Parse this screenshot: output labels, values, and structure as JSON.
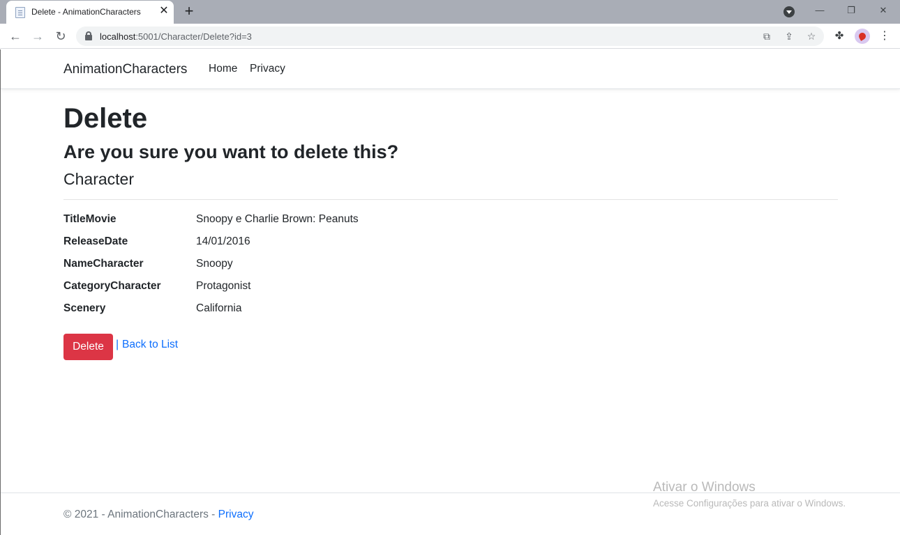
{
  "browser": {
    "tab_title": "Delete - AnimationCharacters",
    "url_host": "localhost",
    "url_path": ":5001/Character/Delete?id=3"
  },
  "site": {
    "brand": "AnimationCharacters",
    "nav": [
      "Home",
      "Privacy"
    ]
  },
  "page": {
    "heading": "Delete",
    "question": "Are you sure you want to delete this?",
    "entity": "Character",
    "fields": [
      {
        "label": "TitleMovie",
        "value": "Snoopy e Charlie Brown: Peanuts"
      },
      {
        "label": "ReleaseDate",
        "value": "14/01/2016"
      },
      {
        "label": "NameCharacter",
        "value": "Snoopy"
      },
      {
        "label": "CategoryCharacter",
        "value": "Protagonist"
      },
      {
        "label": "Scenery",
        "value": "California"
      }
    ],
    "delete_label": "Delete",
    "separator": "|",
    "back_label": "Back to List"
  },
  "footer": {
    "text": "© 2021 - AnimationCharacters - ",
    "link": "Privacy"
  },
  "watermark": {
    "title": "Ativar o Windows",
    "subtitle": "Acesse Configurações para ativar o Windows."
  },
  "colors": {
    "danger": "#dc3545",
    "link": "#0d6efd"
  }
}
